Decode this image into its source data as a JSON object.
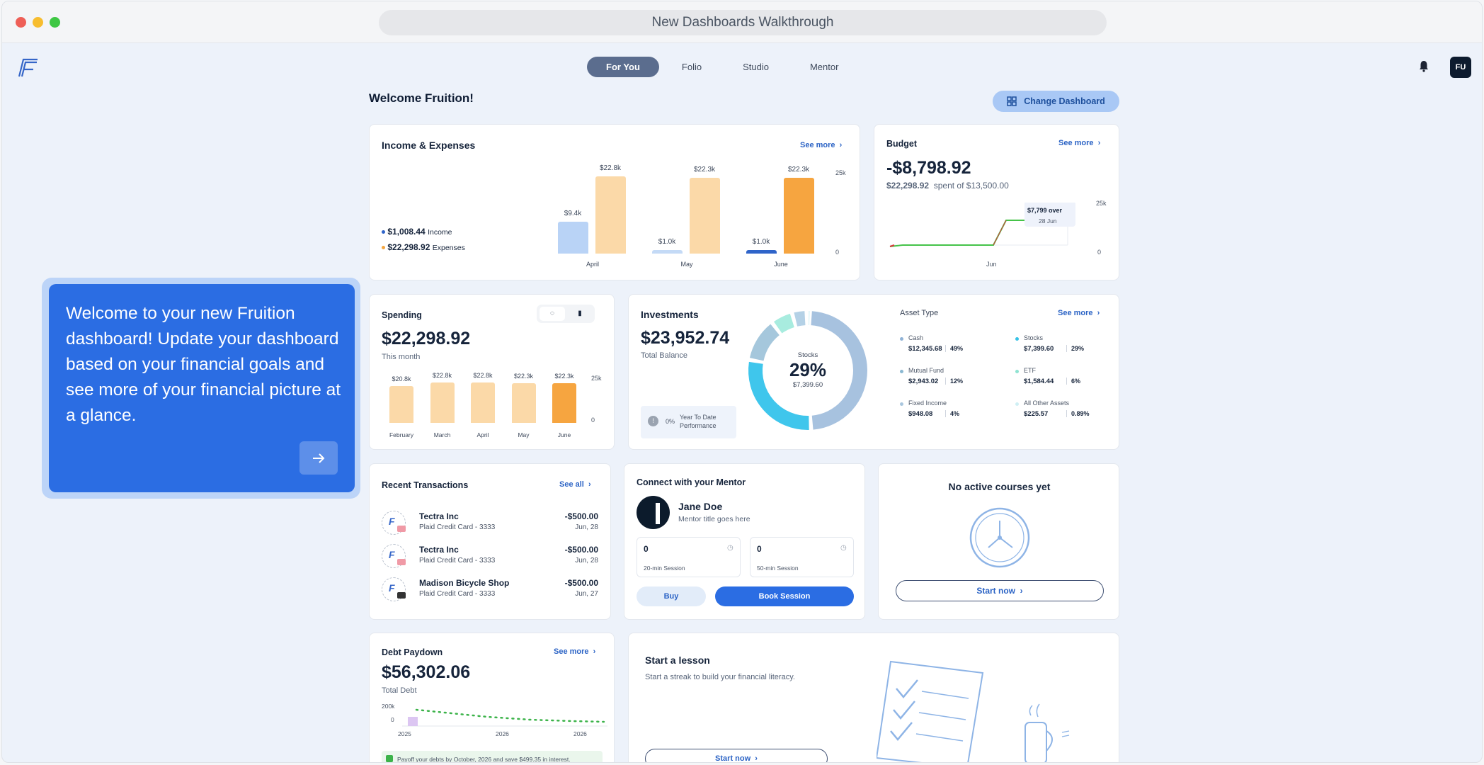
{
  "window": {
    "title": "New Dashboards Walkthrough",
    "traffic_colors": [
      "#ee5f57",
      "#f7bd2f",
      "#3ec744"
    ]
  },
  "nav": {
    "tabs": [
      {
        "label": "For You",
        "active": true
      },
      {
        "label": "Folio"
      },
      {
        "label": "Studio"
      },
      {
        "label": "Mentor"
      }
    ],
    "avatar": "FU"
  },
  "header": {
    "welcome": "Welcome Fruition!",
    "change_dashboard": "Change Dashboard"
  },
  "callout": {
    "text": "Welcome to your new Fruition dashboard! Update your dashboard based on your financial goals and see more of your financial picture at a glance."
  },
  "income_expenses": {
    "title": "Income & Expenses",
    "see_more": "See more",
    "income_value": "$1,008.44",
    "income_label": "Income",
    "expenses_value": "$22,298.92",
    "expenses_label": "Expenses",
    "y_top": "25k",
    "y_zero": "0",
    "chart_data": {
      "type": "bar",
      "categories": [
        "April",
        "May",
        "June"
      ],
      "series": [
        {
          "name": "Income",
          "values": [
            9.4,
            1.0,
            1.0
          ],
          "labels": [
            "$9.4k",
            "$1.0k",
            "$1.0k"
          ]
        },
        {
          "name": "Expenses",
          "values": [
            22.8,
            22.3,
            22.3
          ],
          "labels": [
            "$22.8k",
            "$22.3k",
            "$22.3k"
          ]
        }
      ],
      "ylim": [
        0,
        25
      ]
    }
  },
  "budget": {
    "title": "Budget",
    "see_more": "See more",
    "amount": "-$8,798.92",
    "spent": "$22,298.92",
    "spent_of": "spent of $13,500.00",
    "tooltip_over": "$7,799 over",
    "tooltip_date": "28 Jun",
    "x_label": "Jun",
    "y_top": "25k",
    "y_zero": "0"
  },
  "spending": {
    "title": "Spending",
    "amount": "$22,298.92",
    "period": "This month",
    "y_top": "25k",
    "y_zero": "0",
    "chart_data": {
      "type": "bar",
      "categories": [
        "February",
        "March",
        "April",
        "May",
        "June"
      ],
      "values": [
        20.8,
        22.8,
        22.8,
        22.3,
        22.3
      ],
      "labels": [
        "$20.8k",
        "$22.8k",
        "$22.8k",
        "$22.3k",
        "$22.3k"
      ],
      "ylim": [
        0,
        25
      ]
    }
  },
  "investments": {
    "title": "Investments",
    "balance": "$23,952.74",
    "balance_label": "Total Balance",
    "ytd_pct": "0%",
    "ytd_label": "Year To Date Performance",
    "center_label": "Stocks",
    "center_pct": "29%",
    "center_value": "$7,399.60",
    "asset_type": "Asset Type",
    "see_more": "See more",
    "chart_data": {
      "type": "pie",
      "values": [
        49,
        29,
        12,
        6,
        4,
        0.89
      ],
      "labels": [
        "Cash",
        "Stocks",
        "Mutual Fund",
        "ETF",
        "Fixed Income",
        "All Other Assets"
      ],
      "colors": [
        "#a7c2df",
        "#3fc6ec",
        "#a5c7dc",
        "#a8ecdf",
        "#b4d1e6",
        "#d9f4f7"
      ]
    },
    "assets": [
      {
        "name": "Cash",
        "value": "$12,345.68",
        "pct": "49%",
        "color": "#8fb2d6"
      },
      {
        "name": "Stocks",
        "value": "$7,399.60",
        "pct": "29%",
        "color": "#36c2e6"
      },
      {
        "name": "Mutual Fund",
        "value": "$2,943.02",
        "pct": "12%",
        "color": "#8ab8d2"
      },
      {
        "name": "ETF",
        "value": "$1,584.44",
        "pct": "6%",
        "color": "#8fe3d2"
      },
      {
        "name": "Fixed Income",
        "value": "$948.08",
        "pct": "4%",
        "color": "#a9c6de"
      },
      {
        "name": "All Other Assets",
        "value": "$225.57",
        "pct": "0.89%",
        "color": "#cfeff4"
      }
    ]
  },
  "transactions": {
    "title": "Recent Transactions",
    "see_all": "See all",
    "items": [
      {
        "name": "Tectra Inc",
        "account": "Plaid Credit Card",
        "mask": "3333",
        "amount": "-$500.00",
        "date": "Jun, 28"
      },
      {
        "name": "Tectra Inc",
        "account": "Plaid Credit Card",
        "mask": "3333",
        "amount": "-$500.00",
        "date": "Jun, 28"
      },
      {
        "name": "Madison Bicycle Shop",
        "account": "Plaid Credit Card",
        "mask": "3333",
        "amount": "-$500.00",
        "date": "Jun, 27"
      }
    ]
  },
  "mentor": {
    "title": "Connect with your Mentor",
    "name": "Jane Doe",
    "subtitle": "Mentor title goes here",
    "sessions": [
      {
        "count": "0",
        "label": "20-min Session"
      },
      {
        "count": "0",
        "label": "50-min Session"
      }
    ],
    "buy": "Buy",
    "book": "Book Session"
  },
  "courses": {
    "title": "No active courses yet",
    "start": "Start now"
  },
  "debt": {
    "title": "Debt Paydown",
    "see_more": "See more",
    "amount": "$56,302.06",
    "label": "Total Debt",
    "y_top": "200k",
    "y_zero": "0",
    "x_labels": [
      "2025",
      "2026",
      "2026"
    ],
    "note": "Payoff your debts by October, 2026 and save $499.35 in interest."
  },
  "lesson": {
    "title": "Start a lesson",
    "subtitle": "Start a streak to build your financial literacy.",
    "start": "Start now"
  }
}
